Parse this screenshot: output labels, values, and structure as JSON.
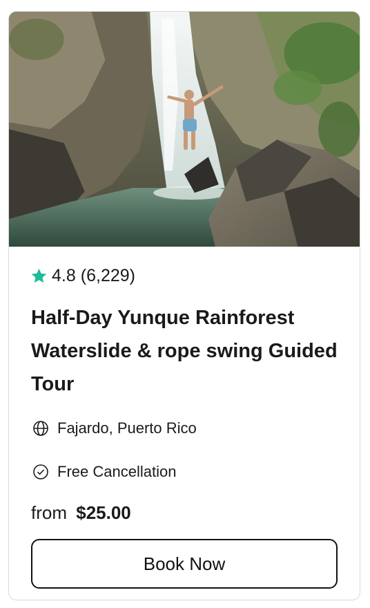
{
  "card": {
    "image_alt": "Person jumping in front of a waterfall into a rainforest pool",
    "rating": {
      "score": "4.8",
      "reviews": "(6,229)",
      "star_color": "#1ebc9b"
    },
    "title": "Half-Day Yunque Rainforest Waterslide & rope swing Guided Tour",
    "location": {
      "icon": "globe-icon",
      "text": "Fajardo, Puerto Rico"
    },
    "cancellation": {
      "icon": "check-circle-icon",
      "text": "Free Cancellation"
    },
    "price": {
      "prefix": "from",
      "amount": "$25.00"
    },
    "book_button": {
      "label": "Book Now"
    }
  }
}
